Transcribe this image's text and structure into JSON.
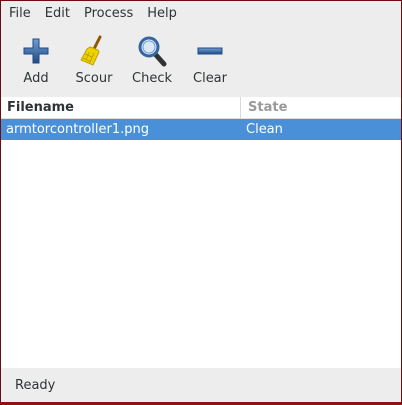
{
  "menubar": {
    "items": [
      {
        "label": "File"
      },
      {
        "label": "Edit"
      },
      {
        "label": "Process"
      },
      {
        "label": "Help"
      }
    ]
  },
  "toolbar": {
    "add_label": "Add",
    "scour_label": "Scour",
    "check_label": "Check",
    "clear_label": "Clear",
    "icons": {
      "add": "plus-icon",
      "scour": "broom-icon",
      "check": "magnifier-icon",
      "clear": "minus-icon"
    }
  },
  "table": {
    "columns": [
      "Filename",
      "State"
    ],
    "rows": [
      {
        "filename": "armtorcontroller1.png",
        "state": "Clean",
        "selected": true
      }
    ]
  },
  "status": {
    "text": "Ready"
  },
  "colors": {
    "selection": "#4a90d9",
    "window_border": "#8c1111",
    "icon_blue": "#3465a4"
  }
}
